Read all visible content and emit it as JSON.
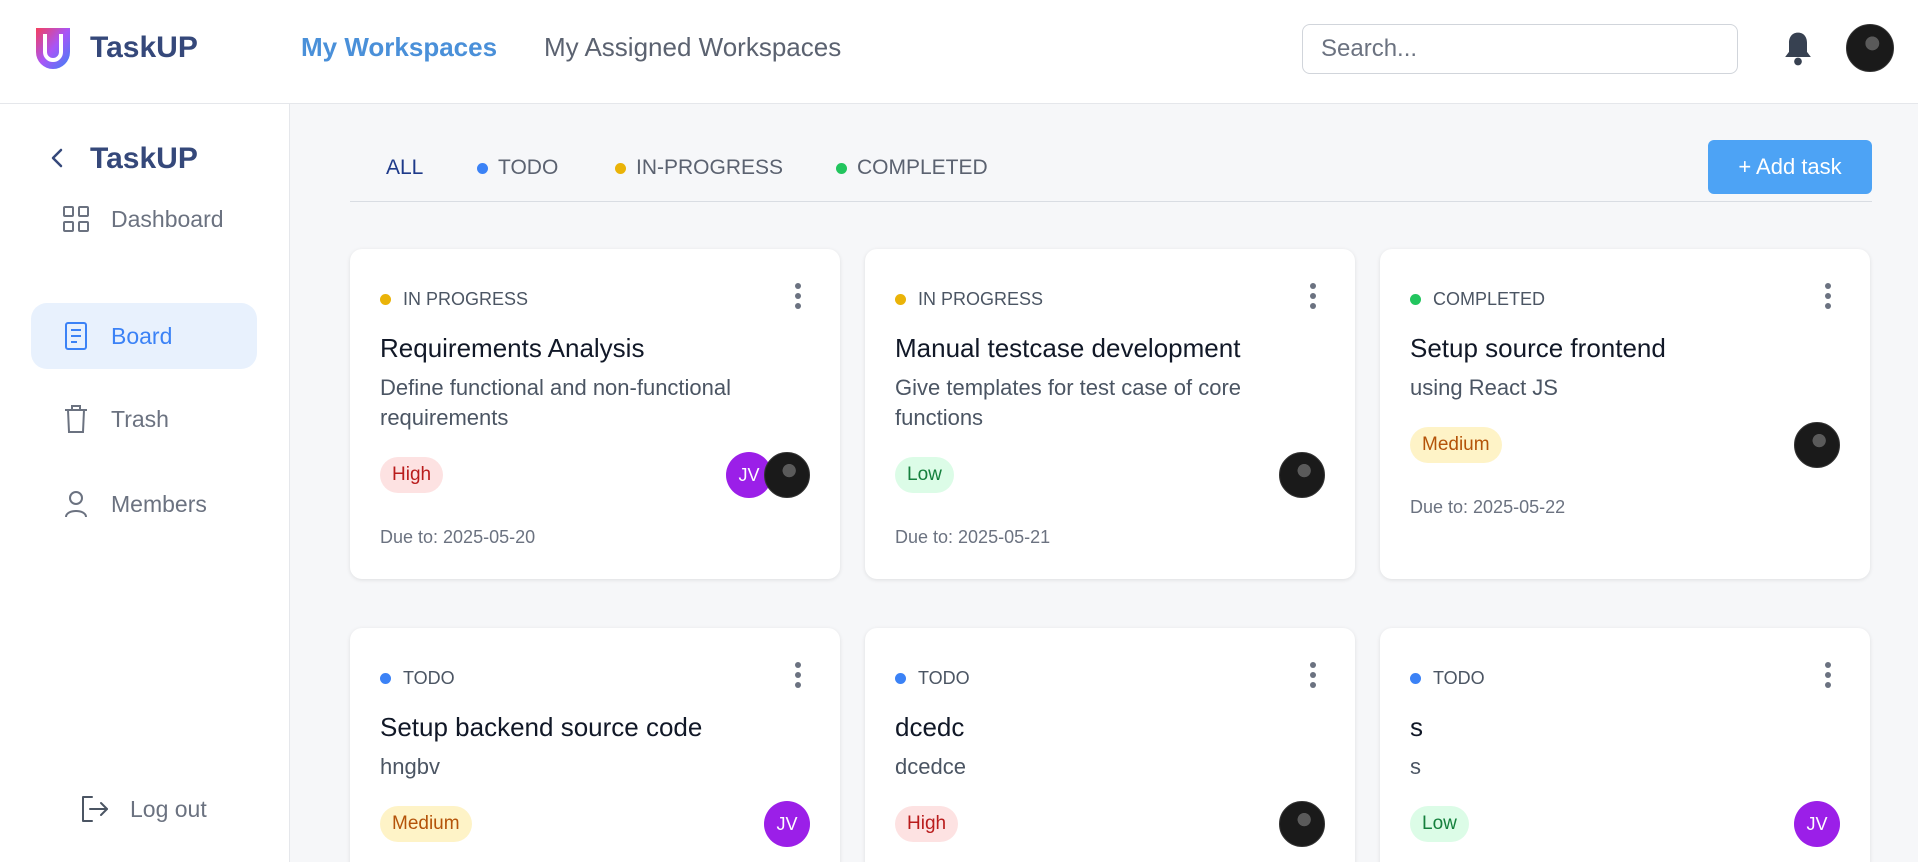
{
  "header": {
    "app_name": "TaskUP",
    "nav_active": "My Workspaces",
    "nav_inactive": "My Assigned Workspaces",
    "search_placeholder": "Search..."
  },
  "sidebar": {
    "title": "TaskUP",
    "items": [
      {
        "label": "Dashboard",
        "icon": "grid-icon"
      },
      {
        "label": "Board",
        "icon": "document-icon"
      },
      {
        "label": "Trash",
        "icon": "trash-icon"
      },
      {
        "label": "Members",
        "icon": "user-icon"
      }
    ],
    "logout_label": "Log out"
  },
  "filters": {
    "tabs": [
      {
        "label": "ALL",
        "color": ""
      },
      {
        "label": "TODO",
        "color": "#3b82f6"
      },
      {
        "label": "IN-PROGRESS",
        "color": "#eab308"
      },
      {
        "label": "COMPLETED",
        "color": "#22c55e"
      }
    ],
    "add_button": "+ Add task"
  },
  "tasks": [
    {
      "status": "IN PROGRESS",
      "status_color": "#eab308",
      "title": "Requirements Analysis",
      "desc": "Define functional and non-functional requirements",
      "priority": "High",
      "due": "Due to: 2025-05-20",
      "assignees": [
        "JV",
        "photo"
      ]
    },
    {
      "status": "IN PROGRESS",
      "status_color": "#eab308",
      "title": "Manual testcase development",
      "desc": "Give templates for test case of core functions",
      "priority": "Low",
      "due": "Due to: 2025-05-21",
      "assignees": [
        "photo"
      ]
    },
    {
      "status": "COMPLETED",
      "status_color": "#22c55e",
      "title": "Setup source frontend",
      "desc": "using React JS",
      "priority": "Medium",
      "due": "Due to: 2025-05-22",
      "assignees": [
        "photo"
      ]
    },
    {
      "status": "TODO",
      "status_color": "#3b82f6",
      "title": "Setup backend source code",
      "desc": "hngbv",
      "priority": "Medium",
      "due": "",
      "assignees": [
        "JV"
      ]
    },
    {
      "status": "TODO",
      "status_color": "#3b82f6",
      "title": "dcedc",
      "desc": "dcedce",
      "priority": "High",
      "due": "",
      "assignees": [
        "photo"
      ]
    },
    {
      "status": "TODO",
      "status_color": "#3b82f6",
      "title": "s",
      "desc": "s",
      "priority": "Low",
      "due": "",
      "assignees": [
        "JV"
      ]
    }
  ]
}
